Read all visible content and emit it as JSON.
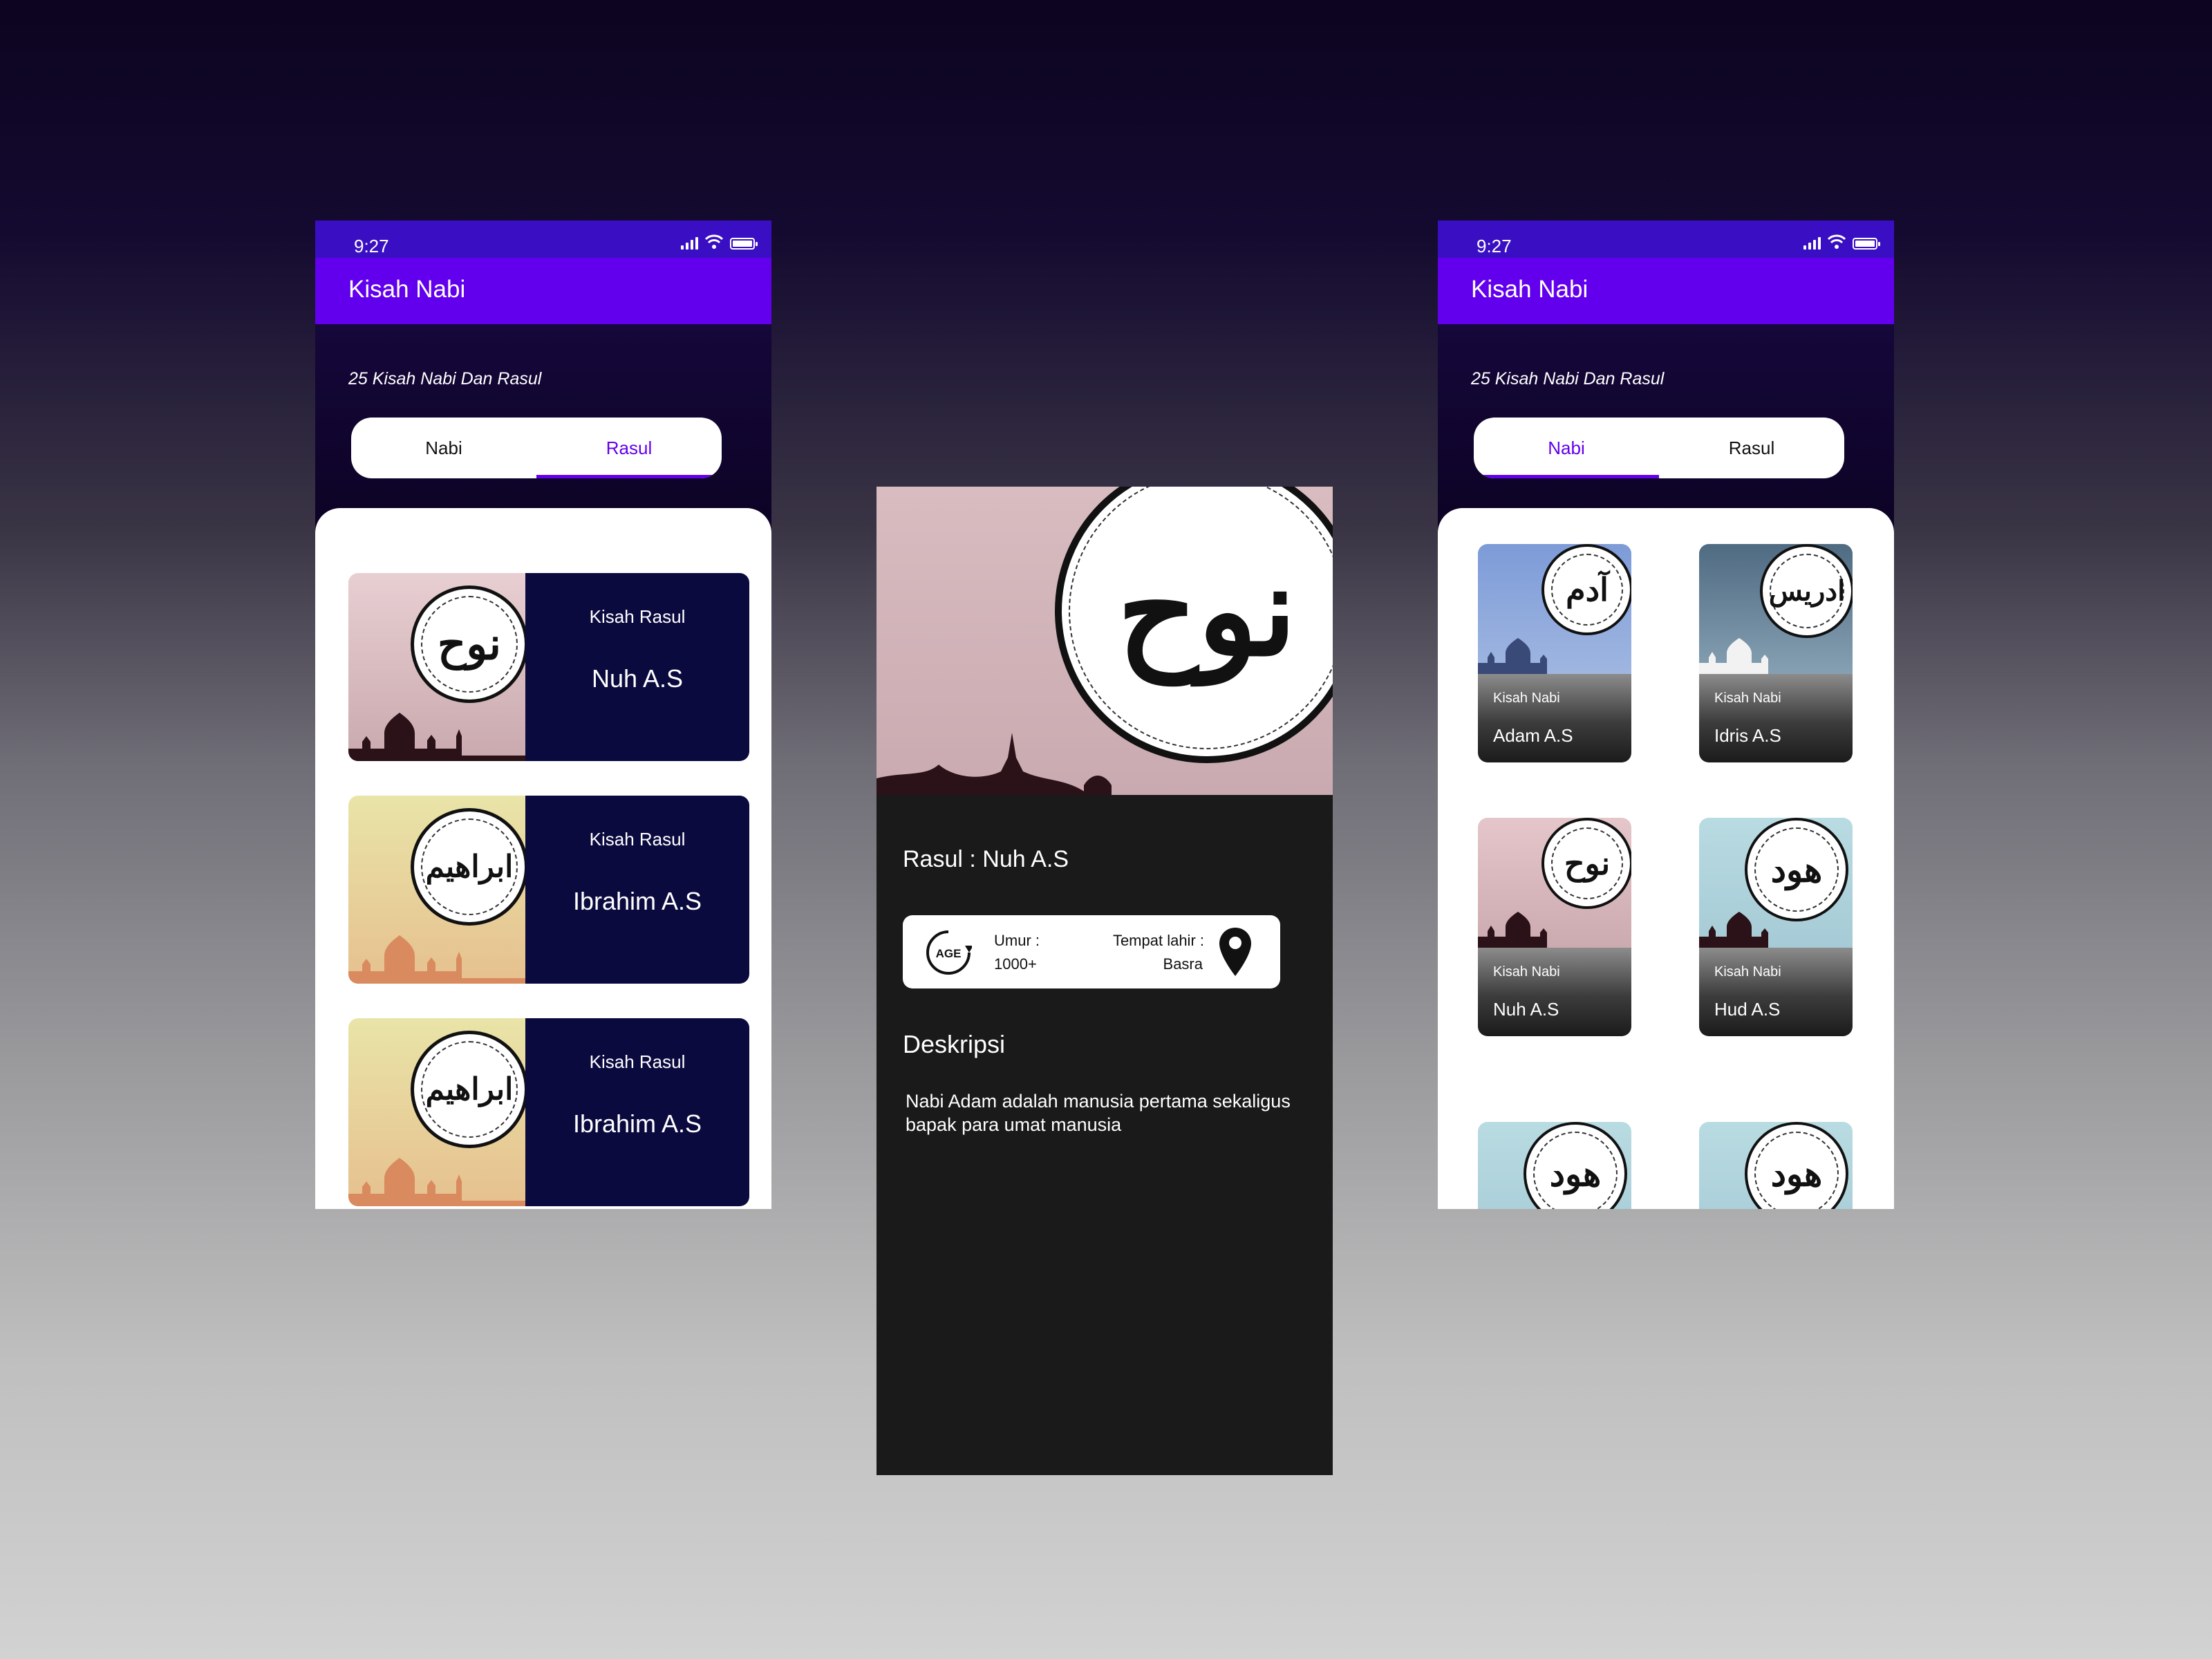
{
  "status_time": "9:27",
  "app_title": "Kisah Nabi",
  "subtitle": "25 Kisah Nabi Dan Rasul",
  "tabs": {
    "nabi": "Nabi",
    "rasul": "Rasul"
  },
  "list_screen": {
    "active_tab": "Rasul",
    "cards": [
      {
        "kicker": "Kisah Rasul",
        "name": "Nuh A.S",
        "image": "nuh-calligraphy"
      },
      {
        "kicker": "Kisah Rasul",
        "name": "Ibrahim A.S",
        "image": "ibrahim-calligraphy"
      },
      {
        "kicker": "Kisah Rasul",
        "name": "Ibrahim A.S",
        "image": "ibrahim-calligraphy"
      }
    ]
  },
  "detail_screen": {
    "title": "Rasul : Nuh A.S",
    "umur_label": "Umur :",
    "umur_value": "1000+",
    "tempat_label": "Tempat lahir :",
    "tempat_value": "Basra",
    "age_icon_text": "AGE",
    "desc_heading": "Deskripsi",
    "desc_text": "Nabi Adam adalah manusia pertama sekaligus bapak para umat manusia"
  },
  "grid_screen": {
    "active_tab": "Nabi",
    "cards": [
      {
        "kicker": "Kisah Nabi",
        "name": "Adam A.S"
      },
      {
        "kicker": "Kisah Nabi",
        "name": "Idris A.S"
      },
      {
        "kicker": "Kisah Nabi",
        "name": "Nuh A.S"
      },
      {
        "kicker": "Kisah Nabi",
        "name": "Hud A.S"
      }
    ]
  },
  "calligraphy": {
    "nuh": "نوح",
    "ibrahim": "ابراهيم",
    "adam": "آدم",
    "idris": "ادريس",
    "hud": "هود"
  },
  "colors": {
    "primary": "#6200ee",
    "status_bar": "#3a0fc4",
    "card_navy": "#0b0a3f",
    "detail_bg": "#1a1a1a"
  }
}
